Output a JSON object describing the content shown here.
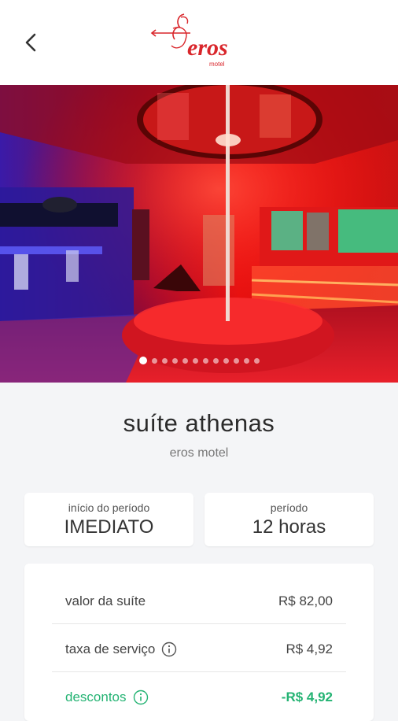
{
  "header": {
    "back_icon": "chevron-left-icon",
    "logo_text": "eros",
    "logo_subtext": "motel",
    "logo_color": "#d9262b"
  },
  "gallery": {
    "total_slides": 12,
    "active_index": 0
  },
  "suite": {
    "name": "suíte athenas",
    "motel": "eros motel"
  },
  "period": {
    "start_label": "início do período",
    "start_value": "IMEDIATO",
    "duration_label": "período",
    "duration_value": "12 horas"
  },
  "pricing": {
    "suite_label": "valor da suíte",
    "suite_value": "R$ 82,00",
    "fee_label": "taxa de serviço",
    "fee_value": "R$ 4,92",
    "discount_label": "descontos",
    "discount_value": "-R$ 4,92",
    "discount_color": "#24b373"
  }
}
